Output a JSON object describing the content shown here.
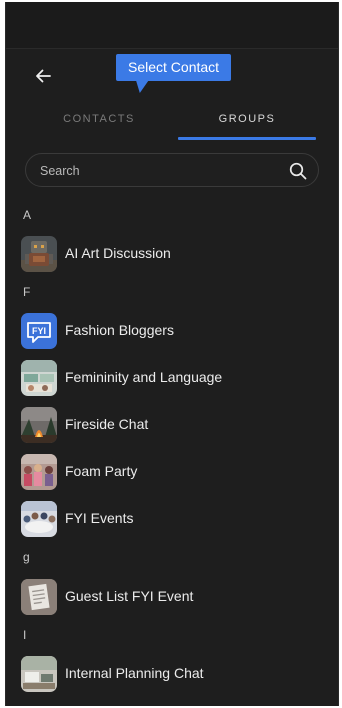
{
  "tooltip": {
    "text": "Select Contact"
  },
  "tabs": [
    {
      "label": "CONTACTS",
      "active": false
    },
    {
      "label": "GROUPS",
      "active": true
    }
  ],
  "search": {
    "placeholder": "Search",
    "value": ""
  },
  "sections": [
    {
      "letter": "A",
      "groups": [
        {
          "name": "AI Art Discussion",
          "avatar": "robot-image"
        }
      ]
    },
    {
      "letter": "F",
      "groups": [
        {
          "name": "Fashion Bloggers",
          "avatar": "fyi-chat-icon"
        },
        {
          "name": "Femininity and Language",
          "avatar": "office-image"
        },
        {
          "name": "Fireside Chat",
          "avatar": "campfire-image"
        },
        {
          "name": "Foam Party",
          "avatar": "party-image"
        },
        {
          "name": "FYI Events",
          "avatar": "meeting-image"
        }
      ]
    },
    {
      "letter": "g",
      "groups": [
        {
          "name": "Guest List FYI Event",
          "avatar": "notepad-image"
        }
      ]
    },
    {
      "letter": "I",
      "groups": [
        {
          "name": "Internal Planning Chat",
          "avatar": "desk-image"
        }
      ]
    }
  ],
  "colors": {
    "accent": "#3b7ae6",
    "background": "#1e1e1e",
    "text": "#ececec",
    "muted": "#7a7a7a"
  }
}
